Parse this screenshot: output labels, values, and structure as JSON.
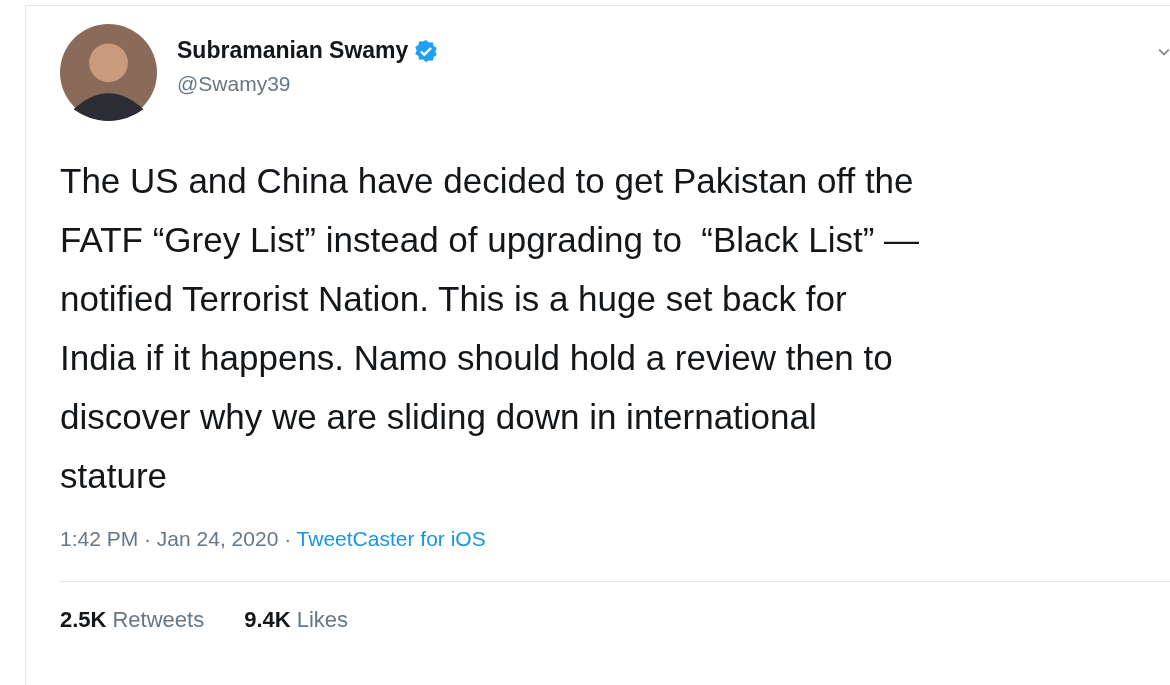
{
  "author": {
    "name": "Subramanian Swamy",
    "verified": true,
    "handle": "@Swamy39"
  },
  "text_lines": [
    "The US and China have decided to get Pakistan off the",
    "FATF “Grey List” instead of upgrading to  “Black List” —",
    "notified Terrorist Nation. This is a huge set back for",
    "India if it happens. Namo should hold a review then to",
    "discover why we are sliding down in international",
    "stature"
  ],
  "meta": {
    "time": "1:42 PM · Jan 24, 2020 · ",
    "source": "TweetCaster for iOS"
  },
  "stats": [
    {
      "count": "2.5K",
      "label": "Retweets"
    },
    {
      "count": "9.4K",
      "label": "Likes"
    }
  ]
}
